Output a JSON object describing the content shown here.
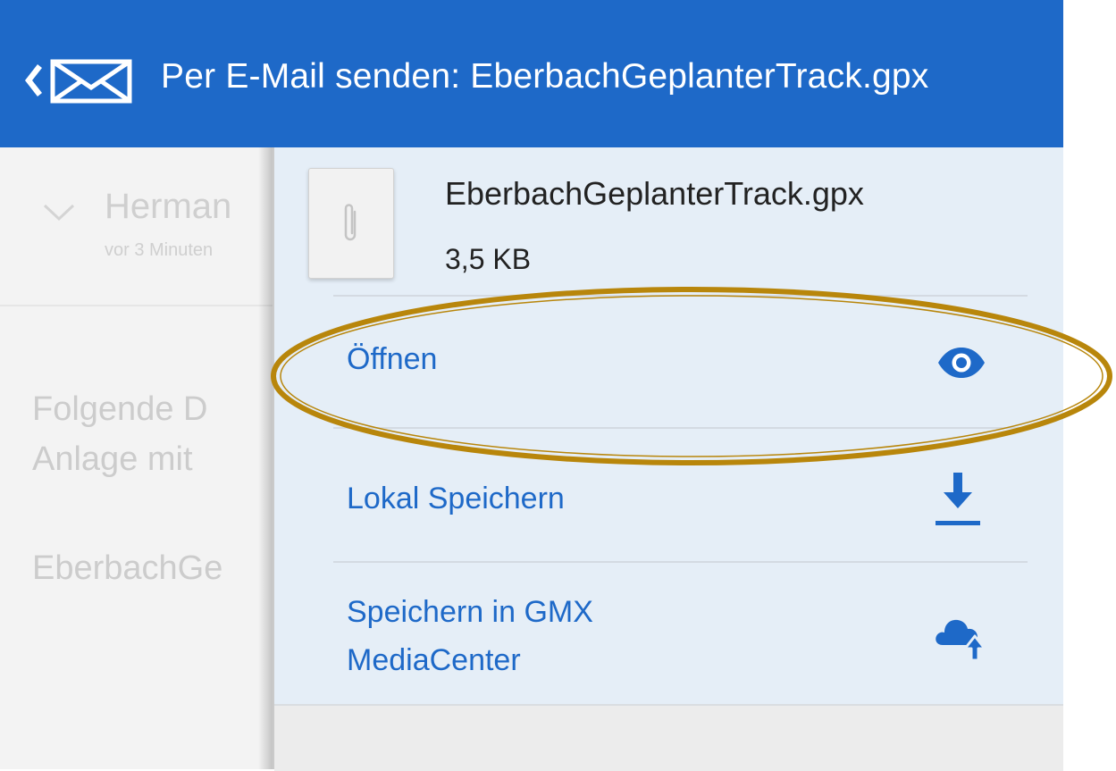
{
  "header": {
    "title": "Per E-Mail senden: EberbachGeplanterTrack.gpx",
    "back_icon": "chevron-left-icon",
    "app_icon": "mail-icon",
    "color": "#1e69c8"
  },
  "background_email": {
    "sender": "Herman",
    "time": "vor 3 Minuten",
    "body_line1": "Folgende D",
    "body_line2": "Anlage mit",
    "attachment_partial": "EberbachGe"
  },
  "sheet": {
    "file": {
      "name": "EberbachGeplanterTrack.gpx",
      "size": "3,5 KB",
      "icon": "paperclip-icon"
    },
    "actions": [
      {
        "label": "Öffnen",
        "icon": "eye-icon"
      },
      {
        "label": "Lokal Speichern",
        "icon": "download-icon"
      },
      {
        "label_line1": "Speichern in GMX",
        "label_line2": "MediaCenter",
        "icon": "cloud-upload-icon"
      }
    ],
    "highlight_color": "#b8860b"
  }
}
